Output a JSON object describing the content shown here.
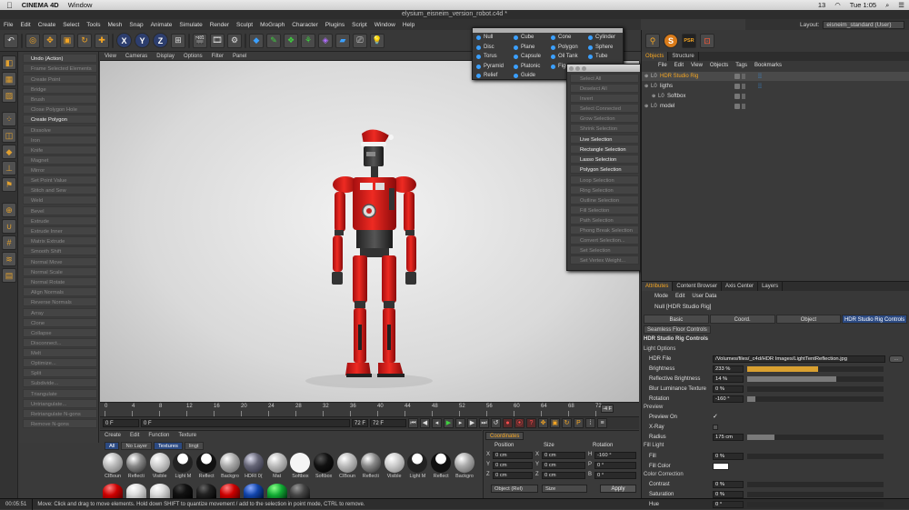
{
  "mac": {
    "app": "CINEMA 4D",
    "window": "Window",
    "battery": "13",
    "clock": "Tue 1:05"
  },
  "title": "elysium_eisneim_version_robot.c4d *",
  "menu": [
    "File",
    "Edit",
    "Create",
    "Select",
    "Tools",
    "Mesh",
    "Snap",
    "Animate",
    "Simulate",
    "Render",
    "Sculpt",
    "MoGraph",
    "Character",
    "Plugins",
    "Script",
    "Window",
    "Help"
  ],
  "layout": {
    "label": "Layout:",
    "value": "eisneim_standard (User)"
  },
  "toolbar": {
    "x": "X",
    "y": "Y",
    "z": "Z"
  },
  "commands": [
    {
      "t": "Undo (Action)",
      "a": true
    },
    {
      "t": "Frame Selected Elements"
    },
    {
      "t": "Create Point"
    },
    {
      "t": "Bridge"
    },
    {
      "t": "Brush"
    },
    {
      "t": "Close Polygon Hole"
    },
    {
      "t": "Create Polygon",
      "a": true
    },
    {
      "t": "Dissolve"
    },
    {
      "t": "Iron"
    },
    {
      "t": "Knife"
    },
    {
      "t": "Magnet"
    },
    {
      "t": "Mirror"
    },
    {
      "t": "Set Point Value"
    },
    {
      "t": "Stitch and Sew"
    },
    {
      "t": "Weld"
    },
    {
      "t": "Bevel"
    },
    {
      "t": "Extrude"
    },
    {
      "t": "Extrude Inner"
    },
    {
      "t": "Matrix Extrude"
    },
    {
      "t": "Smooth Shift"
    },
    {
      "t": "Normal Move"
    },
    {
      "t": "Normal Scale"
    },
    {
      "t": "Normal Rotate"
    },
    {
      "t": "Align Normals"
    },
    {
      "t": "Reverse Normals"
    },
    {
      "t": "Array"
    },
    {
      "t": "Clone"
    },
    {
      "t": "Collapse"
    },
    {
      "t": "Disconnect..."
    },
    {
      "t": "Melt"
    },
    {
      "t": "Optimize..."
    },
    {
      "t": "Split"
    },
    {
      "t": "Subdivide..."
    },
    {
      "t": "Triangulate"
    },
    {
      "t": "Untriangulate..."
    },
    {
      "t": "Retriangulate N-gons"
    },
    {
      "t": "Remove N-gons"
    }
  ],
  "viewport_menu": [
    "View",
    "Cameras",
    "Display",
    "Options",
    "Filter",
    "Panel"
  ],
  "primitives": [
    [
      "Null",
      "Cube",
      "Cone",
      "Cylinder"
    ],
    [
      "Disc",
      "Plane",
      "Polygon",
      "Sphere"
    ],
    [
      "Torus",
      "Capsule",
      "Oil Tank",
      "Tube"
    ],
    [
      "Pyramid",
      "Platonic",
      "Figure",
      ""
    ],
    [
      "Relief",
      "Guide",
      "",
      ""
    ]
  ],
  "select_menu": [
    {
      "t": "Select All"
    },
    {
      "t": "Deselect All"
    },
    {
      "t": "Invert"
    },
    {
      "t": "Select Connected"
    },
    {
      "t": "Grow Selection"
    },
    {
      "t": "Shrink Selection"
    },
    {
      "t": "Live Selection",
      "a": true
    },
    {
      "t": "Rectangle Selection",
      "a": true
    },
    {
      "t": "Lasso Selection",
      "a": true
    },
    {
      "t": "Polygon Selection",
      "a": true
    },
    {
      "t": "Loop Selection"
    },
    {
      "t": "Ring Selection"
    },
    {
      "t": "Outline Selection"
    },
    {
      "t": "Fill Selection"
    },
    {
      "t": "Path Selection"
    },
    {
      "t": "Phong Break Selection"
    },
    {
      "t": "Convert Selection..."
    },
    {
      "t": "Set Selection"
    },
    {
      "t": "Set Vertex Weight..."
    }
  ],
  "timeline": {
    "ticks": [
      "0",
      "4",
      "8",
      "12",
      "16",
      "20",
      "24",
      "28",
      "32",
      "36",
      "40",
      "44",
      "48",
      "52",
      "56",
      "60",
      "64",
      "68",
      "72"
    ],
    "end": "-4 F"
  },
  "transport": {
    "start": "0 F",
    "cur": "0 F",
    "range": "72 F",
    "end": "72 F"
  },
  "materials": {
    "menu": [
      "Create",
      "Edit",
      "Function",
      "Texture"
    ],
    "filters": [
      {
        "t": "All",
        "on": true
      },
      {
        "t": "No Layer",
        "on": false
      },
      {
        "t": "Textures",
        "on": true
      },
      {
        "t": "lingt",
        "on": false
      }
    ],
    "items": [
      {
        "n": "CIBoun",
        "c": "radial-gradient(circle at 35% 30%,#fff,#bbb 40%,#666)"
      },
      {
        "n": "Reflecti",
        "c": "radial-gradient(circle at 35% 30%,#fff,#888 40%,#222)"
      },
      {
        "n": "Visible",
        "c": "radial-gradient(circle at 35% 30%,#fff,#ccc 40%,#777)"
      },
      {
        "n": "Light M",
        "c": "radial-gradient(circle at 50% 30%,#fff 30%,#222 32%)"
      },
      {
        "n": "Reflect",
        "c": "radial-gradient(circle at 50% 30%,#fff 30%,#111 32%)"
      },
      {
        "n": "Backgro",
        "c": "radial-gradient(circle at 35% 30%,#fff,#aaa 40%,#555)"
      },
      {
        "n": "HDRI 0(",
        "c": "radial-gradient(circle at 35% 30%,#dde,#667 40%,#223)"
      },
      {
        "n": "Mat",
        "c": "radial-gradient(circle at 35% 30%,#fff,#bbb 40%,#666)"
      },
      {
        "n": "Softbox",
        "c": "#f5f5f5"
      },
      {
        "n": "Softbox",
        "c": "radial-gradient(circle at 35% 30%,#555,#111 40%,#000)"
      },
      {
        "n": "CIBoun",
        "c": "radial-gradient(circle at 35% 30%,#fff,#bbb 40%,#666)"
      },
      {
        "n": "Reflecti",
        "c": "radial-gradient(circle at 35% 30%,#fff,#888 40%,#222)"
      },
      {
        "n": "Visible",
        "c": "radial-gradient(circle at 35% 30%,#fff,#ccc 40%,#777)"
      },
      {
        "n": "Light M",
        "c": "radial-gradient(circle at 50% 30%,#fff 30%,#222 32%)"
      },
      {
        "n": "Reflect",
        "c": "radial-gradient(circle at 50% 30%,#fff 30%,#111 32%)"
      },
      {
        "n": "Backgro",
        "c": "radial-gradient(circle at 35% 30%,#fff,#aaa 40%,#555)"
      }
    ],
    "row2": [
      "radial-gradient(circle at 35% 30%,#ff8080,#c00 45%,#500)",
      "radial-gradient(circle at 35% 30%,#fff,#ddd 40%,#888)",
      "radial-gradient(circle at 35% 30%,#fff,#ddd 40%,#888)",
      "radial-gradient(circle at 35% 30%,#444,#111 40%,#000)",
      "radial-gradient(circle at 35% 30%,#666,#222 40%,#000)",
      "radial-gradient(circle at 35% 30%,#ff8080,#c00 45%,#500)",
      "radial-gradient(circle at 35% 30%,#8af,#14a 45%,#013)",
      "radial-gradient(circle at 35% 30%,#8f8,#1a3 45%,#031)",
      "radial-gradient(circle at 35% 30%,#999,#444 45%,#111)"
    ]
  },
  "coords": {
    "tab": "Coordinates",
    "h_pos": "Position",
    "h_size": "Size",
    "h_rot": "Rotation",
    "rows": [
      {
        "a": "X",
        "p": "0 cm",
        "s": "X",
        "sv": "0 cm",
        "r": "H",
        "rv": "-160 °"
      },
      {
        "a": "Y",
        "p": "0 cm",
        "s": "Y",
        "sv": "0 cm",
        "r": "P",
        "rv": "0 °"
      },
      {
        "a": "Z",
        "p": "0 cm",
        "s": "Z",
        "sv": "0 cm",
        "r": "B",
        "rv": "0 °"
      }
    ],
    "mode": "Object (Rel)",
    "size": "Size",
    "apply": "Apply"
  },
  "status": {
    "time": "00:05:51",
    "msg": "Move: Click and drag to move elements. Hold down SHIFT to quantize movement / add to the selection in point mode, CTRL to remove."
  },
  "objects": {
    "tabs": [
      {
        "t": "Objects",
        "on": true
      },
      {
        "t": "Structure",
        "on": false
      }
    ],
    "menu": [
      "File",
      "Edit",
      "View",
      "Objects",
      "Tags",
      "Bookmarks"
    ],
    "rows": [
      {
        "t": "HDR Studio Rig",
        "ind": 0,
        "sel": true,
        "col": "#f5a623"
      },
      {
        "t": "ligths",
        "ind": 0,
        "sel": false,
        "col": "#ddd"
      },
      {
        "t": "Softbox",
        "ind": 1,
        "sel": false,
        "col": "#ddd"
      },
      {
        "t": "model",
        "ind": 0,
        "sel": false,
        "col": "#ddd"
      }
    ]
  },
  "attributes": {
    "tabs": [
      {
        "t": "Attributes",
        "on": true
      },
      {
        "t": "Content Browser"
      },
      {
        "t": "Axis Center"
      },
      {
        "t": "Layers"
      }
    ],
    "menu": [
      "Mode",
      "Edit",
      "User Data"
    ],
    "object": "Null [HDR Studio Rig]",
    "subtabs": [
      {
        "t": "Basic"
      },
      {
        "t": "Coord."
      },
      {
        "t": "Object"
      },
      {
        "t": "HDR Studio Rig Controls",
        "on": true
      }
    ],
    "seamless": "Seamless Floor Controls",
    "heading": "HDR Studio Rig Controls",
    "light_options": "Light Options",
    "hdr_file": {
      "k": "HDR File",
      "v": "/Volumes/files/_c4d/HDR Images/LightTentReflection.jpg"
    },
    "brightness": {
      "k": "Brightness",
      "v": "233 %",
      "f": 0.52,
      "hl": true
    },
    "reflective": {
      "k": "Reflective Brightness",
      "v": "14 %",
      "f": 0.65
    },
    "blur": {
      "k": "Blur Luminance Texture",
      "v": "0 %",
      "f": 0
    },
    "rotation": {
      "k": "Rotation",
      "v": "-160 °",
      "f": 0.06
    },
    "preview": "Preview",
    "preview_on": {
      "k": "Preview On",
      "v": "✓"
    },
    "xray": {
      "k": "X-Ray",
      "v": ""
    },
    "radius": {
      "k": "Radius",
      "v": "175 cm",
      "f": 0.2
    },
    "fill_light": "Fill Light",
    "fill": {
      "k": "Fill",
      "v": "0 %",
      "f": 0
    },
    "fill_color": {
      "k": "Fill Color",
      "v": ""
    },
    "color_correction": "Color Correction",
    "contrast": {
      "k": "Contrast",
      "v": "0 %",
      "f": 0
    },
    "saturation": {
      "k": "Saturation",
      "v": "0 %",
      "f": 0
    },
    "hue": {
      "k": "Hue",
      "v": "0 °",
      "f": 0
    }
  }
}
